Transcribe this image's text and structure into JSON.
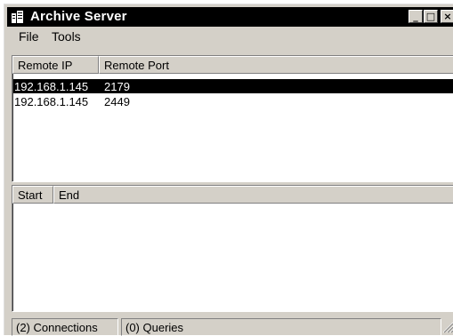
{
  "window": {
    "title": "Archive Server",
    "controls": {
      "minimize": "_",
      "maximize": "□",
      "close": "×"
    }
  },
  "menu": {
    "items": [
      "File",
      "Tools"
    ]
  },
  "connections_list": {
    "columns": [
      "Remote IP",
      "Remote Port"
    ],
    "rows": [
      {
        "remote_ip": "192.168.1.145",
        "remote_port": "2179",
        "selected": true
      },
      {
        "remote_ip": "192.168.1.145",
        "remote_port": "2449",
        "selected": false
      }
    ]
  },
  "queries_list": {
    "columns": [
      "Start",
      "End"
    ],
    "rows": []
  },
  "status_bar": {
    "connections": "(2) Connections",
    "queries": "(0) Queries"
  }
}
